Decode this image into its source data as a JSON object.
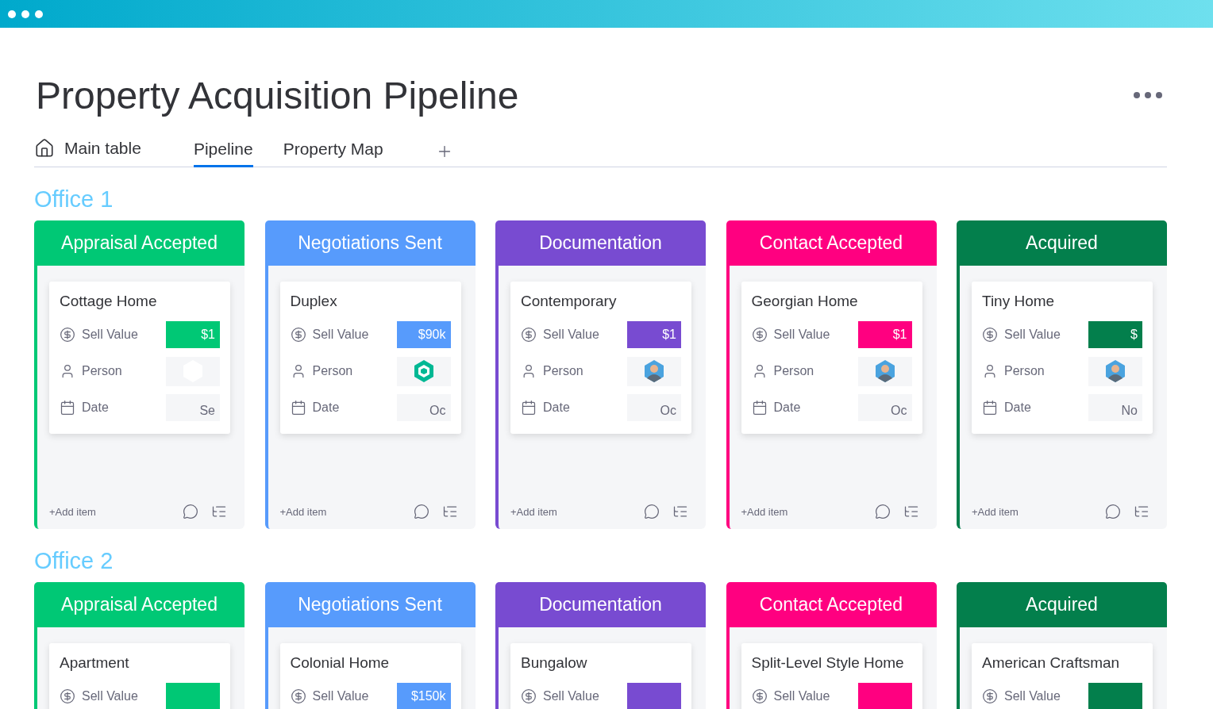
{
  "title": "Property Acquisition Pipeline",
  "tabs": [
    {
      "label": "Main table",
      "kind": "home",
      "selected": false
    },
    {
      "label": "Pipeline",
      "kind": "plain",
      "selected": true
    },
    {
      "label": "Property Map",
      "kind": "plain",
      "selected": false
    }
  ],
  "offices": [
    {
      "name": "Office 1",
      "columns": [
        {
          "title": "Appraisal Accepted",
          "color": "#00c875",
          "add_label": "+Add item",
          "card": {
            "name": "Cottage Home",
            "fields": [
              {
                "kind": "value",
                "label": "Sell Value",
                "value": "$1"
              },
              {
                "kind": "person",
                "label": "Person",
                "avatar": {
                  "kind": "empty"
                }
              },
              {
                "kind": "date",
                "label": "Date",
                "value": "Se"
              }
            ]
          }
        },
        {
          "title": "Negotiations Sent",
          "color": "#579bfc",
          "add_label": "+Add item",
          "card": {
            "name": "Duplex",
            "fields": [
              {
                "kind": "value",
                "label": "Sell Value",
                "value": "$90k"
              },
              {
                "kind": "person",
                "label": "Person",
                "avatar": {
                  "kind": "logo"
                }
              },
              {
                "kind": "date",
                "label": "Date",
                "value": "Oc"
              }
            ]
          }
        },
        {
          "title": "Documentation",
          "color": "#784bd1",
          "add_label": "+Add item",
          "card": {
            "name": "Contemporary",
            "fields": [
              {
                "kind": "value",
                "label": "Sell Value",
                "value": "$1"
              },
              {
                "kind": "person",
                "label": "Person",
                "avatar": {
                  "kind": "person"
                }
              },
              {
                "kind": "date",
                "label": "Date",
                "value": "Oc"
              }
            ]
          }
        },
        {
          "title": "Contact Accepted",
          "color": "#ff0080",
          "add_label": "+Add item",
          "card": {
            "name": "Georgian Home",
            "fields": [
              {
                "kind": "value",
                "label": "Sell Value",
                "value": "$1"
              },
              {
                "kind": "person",
                "label": "Person",
                "avatar": {
                  "kind": "person"
                }
              },
              {
                "kind": "date",
                "label": "Date",
                "value": "Oc"
              }
            ]
          }
        },
        {
          "title": "Acquired",
          "color": "#037f4c",
          "add_label": "+Add item",
          "card": {
            "name": "Tiny Home",
            "fields": [
              {
                "kind": "value",
                "label": "Sell Value",
                "value": "$"
              },
              {
                "kind": "person",
                "label": "Person",
                "avatar": {
                  "kind": "person"
                }
              },
              {
                "kind": "date",
                "label": "Date",
                "value": "No"
              }
            ]
          }
        }
      ]
    },
    {
      "name": "Office 2",
      "columns": [
        {
          "title": "Appraisal Accepted",
          "color": "#00c875",
          "card": {
            "name": "Apartment",
            "fields": [
              {
                "kind": "value",
                "label": "Sell Value"
              }
            ]
          }
        },
        {
          "title": "Negotiations Sent",
          "color": "#579bfc",
          "card": {
            "name": "Colonial Home",
            "fields": [
              {
                "kind": "value",
                "label": "Sell Value",
                "value": "$150k"
              }
            ]
          }
        },
        {
          "title": "Documentation",
          "color": "#784bd1",
          "card": {
            "name": "Bungalow",
            "fields": [
              {
                "kind": "value",
                "label": "Sell Value"
              }
            ]
          }
        },
        {
          "title": "Contact Accepted",
          "color": "#ff0080",
          "card": {
            "name": "Split-Level Style Home",
            "fields": [
              {
                "kind": "value",
                "label": "Sell Value"
              }
            ]
          }
        },
        {
          "title": "Acquired",
          "color": "#037f4c",
          "card": {
            "name": "American Craftsman",
            "fields": [
              {
                "kind": "value",
                "label": "Sell Value"
              }
            ]
          }
        }
      ]
    }
  ]
}
